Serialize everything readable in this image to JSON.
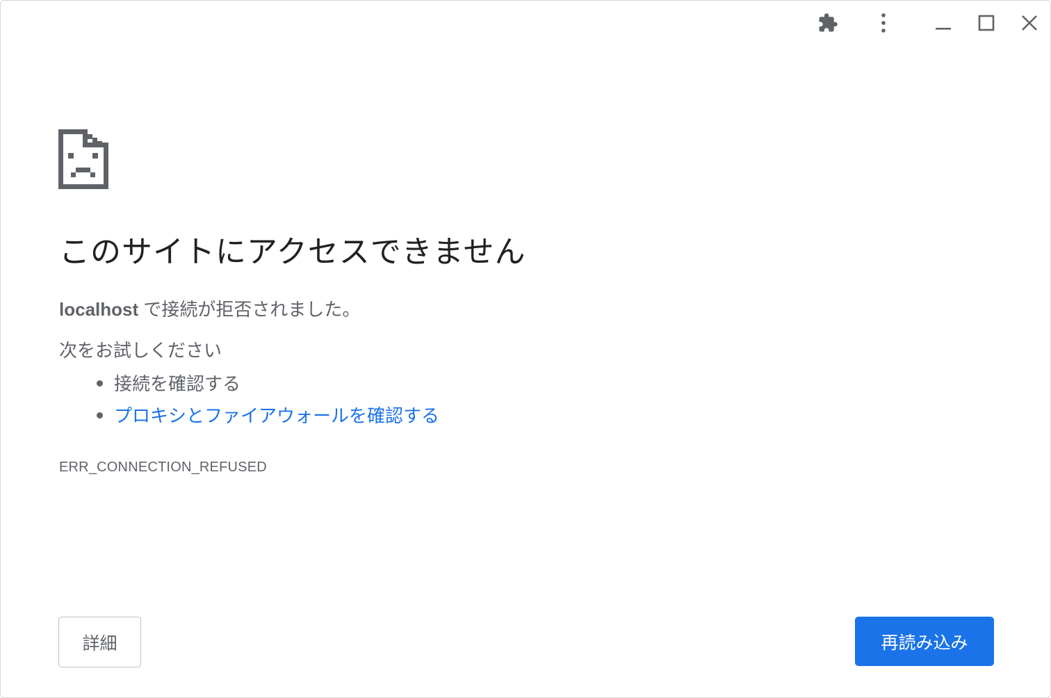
{
  "window_controls": {
    "extensions_icon": "puzzle-icon",
    "menu_icon": "vertical-dots-icon",
    "minimize_icon": "minimize-icon",
    "maximize_icon": "maximize-icon",
    "close_icon": "close-icon"
  },
  "error": {
    "icon": "sad-document-icon",
    "title": "このサイトにアクセスできません",
    "host": "localhost",
    "message": " で接続が拒否されました。",
    "try_label": "次をお試しください",
    "suggestions": [
      {
        "label": "接続を確認する",
        "is_link": false
      },
      {
        "label": "プロキシとファイアウォールを確認する",
        "is_link": true
      }
    ],
    "code": "ERR_CONNECTION_REFUSED"
  },
  "buttons": {
    "details_label": "詳細",
    "reload_label": "再読み込み"
  },
  "colors": {
    "link": "#1a73e8",
    "primary_button": "#1a73e8",
    "text_secondary": "#5f6368",
    "text_primary": "#202124"
  }
}
